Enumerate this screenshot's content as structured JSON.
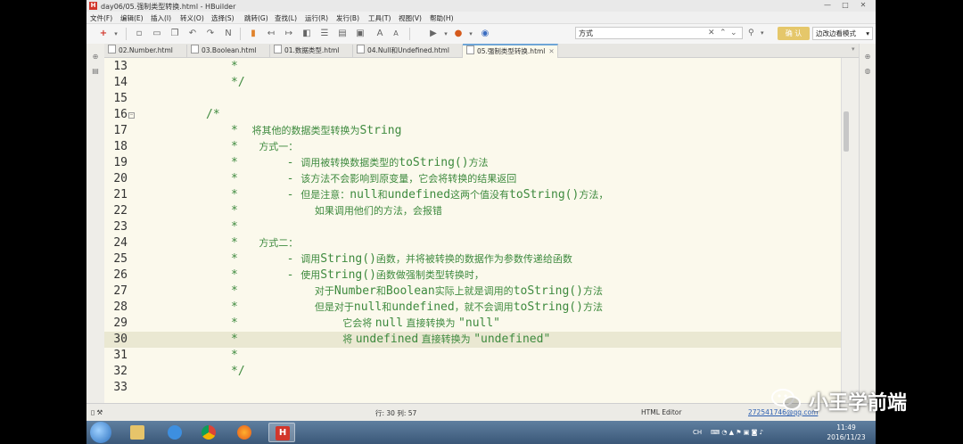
{
  "window": {
    "app_icon_letter": "H",
    "title": "day06/05.强制类型转换.html - HBuilder",
    "controls": [
      "—",
      "□",
      "✕"
    ]
  },
  "menu": [
    "文件(F)",
    "编辑(E)",
    "插入(I)",
    "转义(O)",
    "选择(S)",
    "跳转(G)",
    "查找(L)",
    "运行(R)",
    "发行(B)",
    "工具(T)",
    "视图(V)",
    "帮助(H)"
  ],
  "toolbar": {
    "search_value": "方式",
    "confirm_label": "确 认",
    "mode_label": "边改边看模式"
  },
  "tabs": [
    {
      "label": "02.Number.html",
      "active": false
    },
    {
      "label": "03.Boolean.html",
      "active": false
    },
    {
      "label": "01.数据类型.html",
      "active": false
    },
    {
      "label": "04.Null和Undefined.html",
      "active": false
    },
    {
      "label": "05.强制类型转换.html",
      "active": true
    }
  ],
  "editor": {
    "current_line": 30,
    "lines": [
      {
        "n": "13",
        "segs": [
          {
            "t": "*",
            "c": "mono"
          }
        ]
      },
      {
        "n": "14",
        "segs": [
          {
            "t": "*/",
            "c": "mono"
          }
        ]
      },
      {
        "n": "15",
        "segs": []
      },
      {
        "n": "16",
        "fold": true,
        "segs": [
          {
            "t": "/*",
            "c": "mono"
          }
        ]
      },
      {
        "n": "17",
        "segs": [
          {
            "t": "*  ",
            "c": "mono"
          },
          {
            "t": "将其他的数据类型转换为",
            "c": "cn"
          },
          {
            "t": "String",
            "c": "kw"
          }
        ]
      },
      {
        "n": "18",
        "segs": [
          {
            "t": "*   ",
            "c": "mono"
          },
          {
            "t": "方式一：",
            "c": "cn"
          }
        ]
      },
      {
        "n": "19",
        "segs": [
          {
            "t": "*       - ",
            "c": "mono"
          },
          {
            "t": "调用被转换数据类型的",
            "c": "cn"
          },
          {
            "t": "toString()",
            "c": "kw"
          },
          {
            "t": "方法",
            "c": "cn"
          }
        ]
      },
      {
        "n": "20",
        "segs": [
          {
            "t": "*       - ",
            "c": "mono"
          },
          {
            "t": "该方法不会影响到原变量，它会将转换的结果返回",
            "c": "cn"
          }
        ]
      },
      {
        "n": "21",
        "segs": [
          {
            "t": "*       - ",
            "c": "mono"
          },
          {
            "t": "但是注意：",
            "c": "cn"
          },
          {
            "t": "null",
            "c": "kw"
          },
          {
            "t": "和",
            "c": "cn"
          },
          {
            "t": "undefined",
            "c": "kw"
          },
          {
            "t": "这两个值没有",
            "c": "cn"
          },
          {
            "t": "toString()",
            "c": "kw"
          },
          {
            "t": "方法，",
            "c": "cn"
          }
        ]
      },
      {
        "n": "22",
        "segs": [
          {
            "t": "*           ",
            "c": "mono"
          },
          {
            "t": "如果调用他们的方法，会报错",
            "c": "cn"
          }
        ]
      },
      {
        "n": "23",
        "segs": [
          {
            "t": "*",
            "c": "mono"
          }
        ]
      },
      {
        "n": "24",
        "segs": [
          {
            "t": "*   ",
            "c": "mono"
          },
          {
            "t": "方式二：",
            "c": "cn"
          }
        ]
      },
      {
        "n": "25",
        "segs": [
          {
            "t": "*       - ",
            "c": "mono"
          },
          {
            "t": "调用",
            "c": "cn"
          },
          {
            "t": "String()",
            "c": "kw"
          },
          {
            "t": "函数，并将被转换的数据作为参数传递给函数",
            "c": "cn"
          }
        ]
      },
      {
        "n": "26",
        "segs": [
          {
            "t": "*       - ",
            "c": "mono"
          },
          {
            "t": "使用",
            "c": "cn"
          },
          {
            "t": "String()",
            "c": "kw"
          },
          {
            "t": "函数做强制类型转换时，",
            "c": "cn"
          }
        ]
      },
      {
        "n": "27",
        "segs": [
          {
            "t": "*           ",
            "c": "mono"
          },
          {
            "t": "对于",
            "c": "cn"
          },
          {
            "t": "Number",
            "c": "kw"
          },
          {
            "t": "和",
            "c": "cn"
          },
          {
            "t": "Boolean",
            "c": "kw"
          },
          {
            "t": "实际上就是调用的",
            "c": "cn"
          },
          {
            "t": "toString()",
            "c": "kw"
          },
          {
            "t": "方法",
            "c": "cn"
          }
        ]
      },
      {
        "n": "28",
        "segs": [
          {
            "t": "*           ",
            "c": "mono"
          },
          {
            "t": "但是对于",
            "c": "cn"
          },
          {
            "t": "null",
            "c": "kw"
          },
          {
            "t": "和",
            "c": "cn"
          },
          {
            "t": "undefined",
            "c": "kw"
          },
          {
            "t": "，就不会调用",
            "c": "cn"
          },
          {
            "t": "toString()",
            "c": "kw"
          },
          {
            "t": "方法",
            "c": "cn"
          }
        ]
      },
      {
        "n": "29",
        "segs": [
          {
            "t": "*               ",
            "c": "mono"
          },
          {
            "t": "它会将 ",
            "c": "cn"
          },
          {
            "t": "null",
            "c": "kw"
          },
          {
            "t": " 直接转换为 ",
            "c": "cn"
          },
          {
            "t": "\"null\"",
            "c": "kw"
          }
        ]
      },
      {
        "n": "30",
        "segs": [
          {
            "t": "*               ",
            "c": "mono"
          },
          {
            "t": "将 ",
            "c": "cn"
          },
          {
            "t": "undefined",
            "c": "kw"
          },
          {
            "t": " 直接转换为 ",
            "c": "cn"
          },
          {
            "t": "\"undefined\"",
            "c": "kw"
          }
        ]
      },
      {
        "n": "31",
        "segs": [
          {
            "t": "*",
            "c": "mono"
          }
        ]
      },
      {
        "n": "32",
        "segs": [
          {
            "t": "*/",
            "c": "mono"
          }
        ]
      },
      {
        "n": "33",
        "segs": []
      }
    ]
  },
  "statusbar": {
    "position": "行: 30 列: 57",
    "editor_type": "HTML Editor",
    "user": "272541746@qq.com"
  },
  "taskbar": {
    "apps": [
      "start",
      "explorer",
      "ie",
      "chrome",
      "firefox",
      "hbuilder"
    ],
    "active_app": "hbuilder",
    "ime": "CH",
    "time": "11:49",
    "date": "2016/11/23"
  },
  "watermark": {
    "text": "小王学前端"
  },
  "colors": {
    "comment_green": "#3e8a3e",
    "editor_bg": "#fbf9ec",
    "current_line_bg": "#eae8d2",
    "brand_red": "#d2362b"
  }
}
